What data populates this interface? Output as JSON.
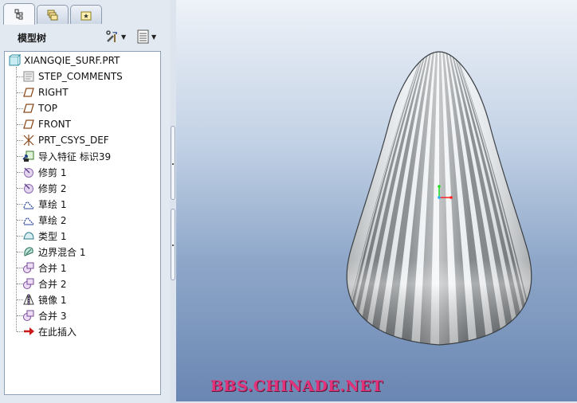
{
  "tabs": [
    {
      "name": "model-tree-tab",
      "icon": "model-tree-icon",
      "active": true
    },
    {
      "name": "layers-tab",
      "icon": "layers-icon",
      "active": false
    },
    {
      "name": "favorites-tab",
      "icon": "favorites-folder-icon",
      "active": false
    }
  ],
  "panel": {
    "title": "模型树",
    "settings_icon": "tools-icon",
    "show_icon": "list-view-icon"
  },
  "tree": {
    "root": "XIANGQIE_SURF.PRT",
    "items": [
      {
        "label": "STEP_COMMENTS",
        "icon": "note-icon"
      },
      {
        "label": "RIGHT",
        "icon": "datum-plane-icon"
      },
      {
        "label": "TOP",
        "icon": "datum-plane-icon"
      },
      {
        "label": "FRONT",
        "icon": "datum-plane-icon"
      },
      {
        "label": "PRT_CSYS_DEF",
        "icon": "coordinate-system-icon"
      },
      {
        "label": "导入特征 标识39",
        "icon": "import-feature-icon"
      },
      {
        "label": "修剪 1",
        "icon": "trim-icon"
      },
      {
        "label": "修剪 2",
        "icon": "trim-icon"
      },
      {
        "label": "草绘 1",
        "icon": "sketch-icon"
      },
      {
        "label": "草绘 2",
        "icon": "sketch-icon"
      },
      {
        "label": "类型 1",
        "icon": "surface-icon"
      },
      {
        "label": "边界混合 1",
        "icon": "boundary-blend-icon"
      },
      {
        "label": "合并 1",
        "icon": "merge-icon"
      },
      {
        "label": "合并 2",
        "icon": "merge-icon"
      },
      {
        "label": "镜像 1",
        "icon": "mirror-icon"
      },
      {
        "label": "合并 3",
        "icon": "merge-icon"
      },
      {
        "label": "在此插入",
        "icon": "insert-here-arrow-icon"
      }
    ]
  },
  "viewport": {
    "watermark": "BBS.CHINADE.NET",
    "model": "striped-cone-surface"
  }
}
